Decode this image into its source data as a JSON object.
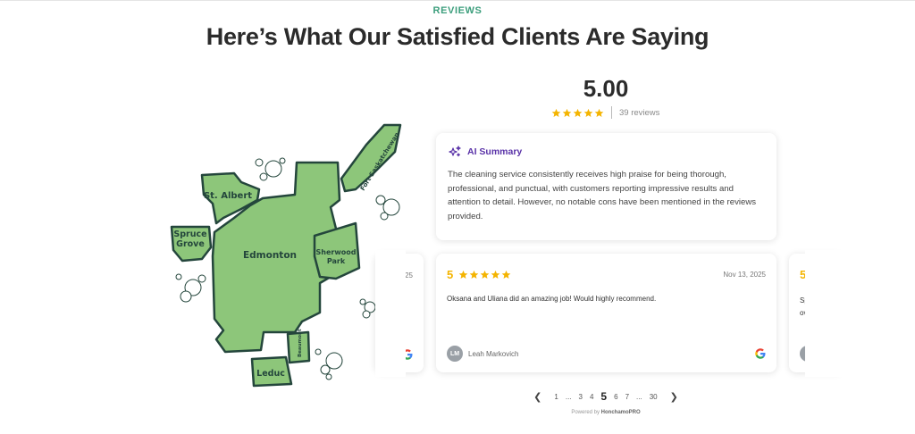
{
  "section": {
    "eyebrow": "REVIEWS",
    "headline": "Here’s What Our Satisfied Clients Are Saying"
  },
  "map": {
    "regions": [
      "St. Albert",
      "Spruce",
      "Grove",
      "Edmonton",
      "Sherwood",
      "Park",
      "Fort Saskatchewan",
      "Beaumont",
      "Leduc"
    ],
    "fill_color": "#8dc67a",
    "outline_color": "#24463c"
  },
  "summary": {
    "rating": "5.00",
    "stars": 5,
    "reviews_label": "39 reviews"
  },
  "ai_summary": {
    "title": "AI Summary",
    "text": "The cleaning service consistently receives high praise for being thorough, professional, and punctual, with customers reporting impressive results and attention to detail. However, no notable cons have been mentioned in the reviews provided."
  },
  "reviews": {
    "current": {
      "score": "5",
      "date": "Nov 13, 2025",
      "text": "Oksana and Uliana did an amazing job! Would highly recommend.",
      "initials": "LM",
      "author": "Leah Markovich"
    },
    "prev_fragment": {
      "date": "25"
    },
    "next_fragment": {
      "score": "5",
      "line1": "Sp",
      "line2": "ov"
    }
  },
  "pagination": {
    "pages": [
      "1",
      "...",
      "3",
      "4",
      "5",
      "6",
      "7",
      "...",
      "30"
    ],
    "active": "5"
  },
  "footer": {
    "powered_prefix": "Powered by",
    "powered_brand": "HonchamoPRO"
  },
  "colors": {
    "accent_green": "#3c9e7c",
    "star": "#f4b400",
    "ai_purple": "#5a33a8"
  }
}
